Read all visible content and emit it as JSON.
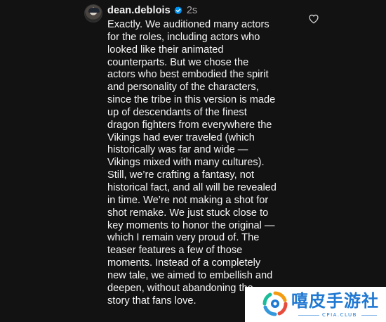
{
  "comment": {
    "username": "dean.deblois",
    "verified": true,
    "time": "2s",
    "text": "Exactly. We auditioned many actors\nfor the roles, including actors who\nlooked like their animated\ncounterparts. But we chose the\nactors who best embodied the spirit\nand personality of the characters,\nsince the tribe in this version is made\nup of descendants of the finest\ndragon fighters from everywhere the\nVikings had ever traveled (which\nhistorically was far and wide —\nVikings mixed with many cultures).\nStill, we’re crafting a fantasy, not\nhistorical fact, and all will be revealed\nin time. We’re not making a shot for\nshot remake. We just stuck close to\nkey moments to honor the original —\nwhich I remain very proud of. The\nteaser features a few of those\nmoments. Instead of a completely\nnew tale, we aimed to embellish and\ndeepen, without abandoning the\nstory that fans love."
  },
  "icons": {
    "like": "heart-outline-icon",
    "verified": "verified-badge-icon",
    "avatar": "profile-avatar"
  },
  "watermark": {
    "title": "嘻皮手游社",
    "subtitle": "CPIA.CLUB"
  },
  "colors": {
    "background": "#121212",
    "text": "#f5f5f5",
    "muted": "#a8a8a8",
    "verified": "#0095f6",
    "watermark": "#1f78d1"
  }
}
